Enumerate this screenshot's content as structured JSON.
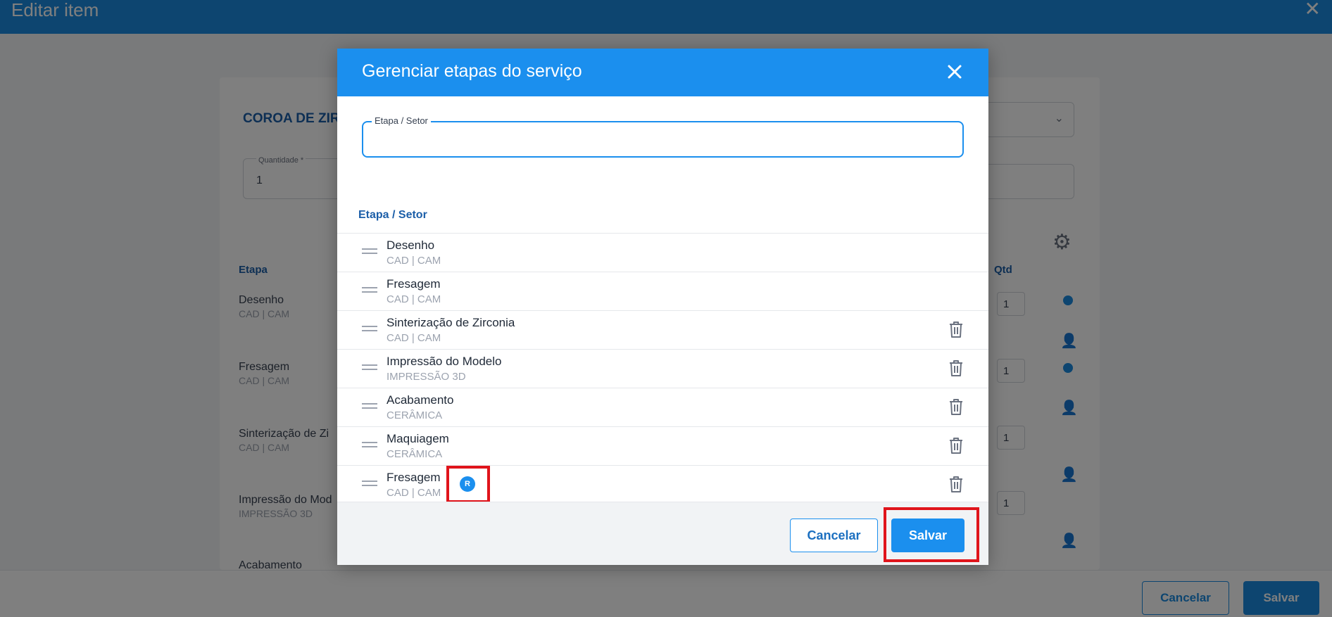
{
  "background": {
    "title": "Editar item",
    "product": "COROA DE ZIR",
    "quantity_label": "Quantidade *",
    "quantity_value": "1",
    "col_etapa": "Etapa",
    "col_qtd": "Qtd",
    "rows": [
      {
        "name": "Desenho",
        "sector": "CAD | CAM",
        "qty": "1"
      },
      {
        "name": "Fresagem",
        "sector": "CAD | CAM",
        "qty": "1"
      },
      {
        "name": "Sinterização de Zi",
        "sector": "CAD | CAM",
        "qty": "1"
      },
      {
        "name": "Impressão do Mod",
        "sector": "IMPRESSÃO 3D",
        "qty": "1"
      },
      {
        "name": "Acabamento",
        "sector": "",
        "qty": ""
      }
    ],
    "cancel_label": "Cancelar",
    "save_label": "Salvar"
  },
  "modal": {
    "title": "Gerenciar etapas do serviço",
    "field_label": "Etapa / Setor",
    "field_value": "",
    "list_header": "Etapa / Setor",
    "items": [
      {
        "name": "Desenho",
        "sector": "CAD | CAM",
        "deletable": false
      },
      {
        "name": "Fresagem",
        "sector": "CAD | CAM",
        "deletable": false
      },
      {
        "name": "Sinterização de Zirconia",
        "sector": "CAD | CAM",
        "deletable": true
      },
      {
        "name": "Impressão do Modelo",
        "sector": "IMPRESSÃO 3D",
        "deletable": true
      },
      {
        "name": "Acabamento",
        "sector": "CERÂMICA",
        "deletable": true
      },
      {
        "name": "Maquiagem",
        "sector": "CERÂMICA",
        "deletable": true
      },
      {
        "name": "Fresagem",
        "sector": "CAD | CAM",
        "deletable": true,
        "badge": "R"
      }
    ],
    "cancel_label": "Cancelar",
    "save_label": "Salvar"
  },
  "icons": {
    "close": "close-icon",
    "drag": "drag-handle-icon",
    "trash": "trash-icon",
    "gear": "gear-icon",
    "person_add": "person-add-icon"
  },
  "colors": {
    "primary": "#1b8fee",
    "highlight": "#e0141b"
  }
}
